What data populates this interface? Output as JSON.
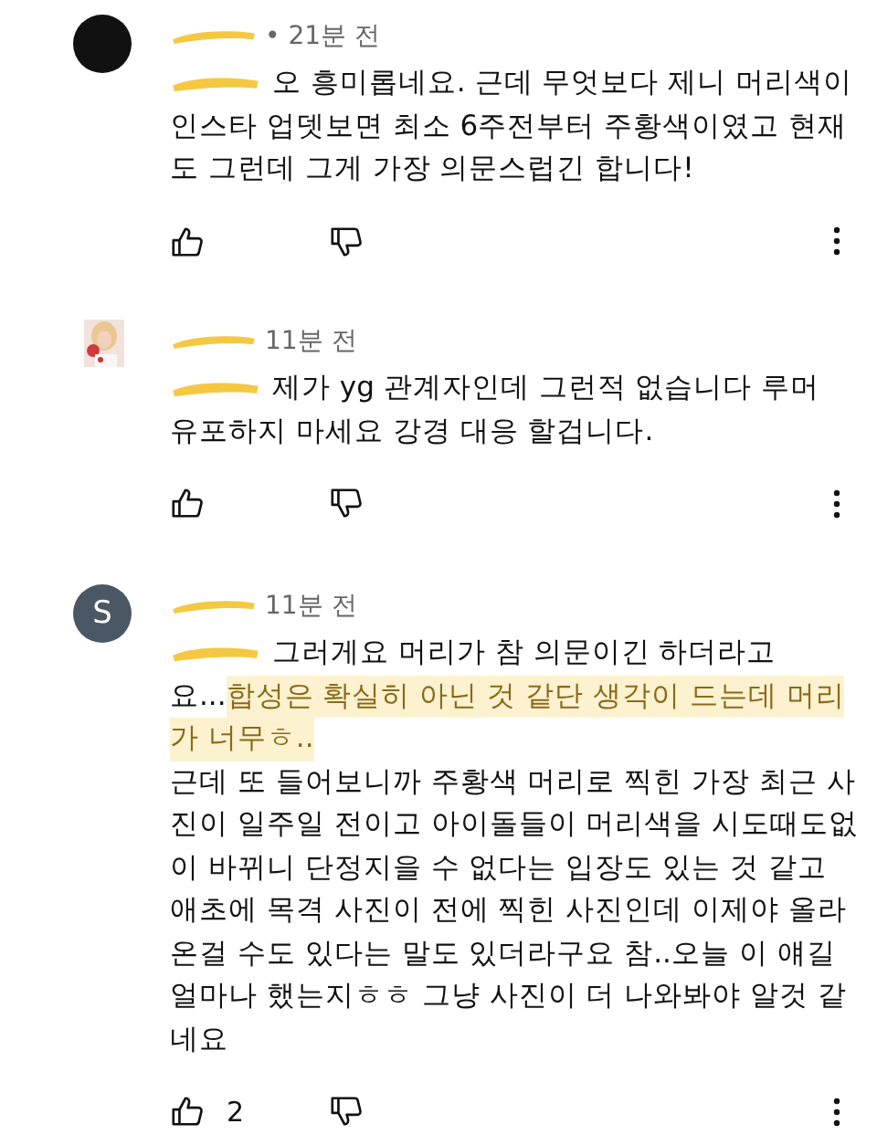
{
  "comments": [
    {
      "avatar": {
        "kind": "dark"
      },
      "author_redacted": true,
      "time": "• 21분 전",
      "mention_redacted": true,
      "lines": [
        [
          {
            "text": "오 흥미롭네요. 근데 무엇보다 제니 머리색이",
            "highlighted": false
          }
        ],
        [
          {
            "text": "인스타 업뎃보면 최소 6주전부터 주황색이였고 현재",
            "highlighted": false
          }
        ],
        [
          {
            "text": "도 그런데 그게 가장 의문스럽긴 합니다!",
            "highlighted": false
          }
        ]
      ]
    },
    {
      "avatar": {
        "kind": "picture"
      },
      "author_redacted": true,
      "time": "11분 전",
      "mention_redacted": true,
      "lines": [
        [
          {
            "text": "제가 yg 관계자인데 그런적 없습니다 루머",
            "highlighted": false
          }
        ],
        [
          {
            "text": "유포하지 마세요 강경 대응 할겁니다.",
            "highlighted": false
          }
        ]
      ]
    },
    {
      "avatar": {
        "kind": "letter",
        "letter": "S"
      },
      "author_redacted": true,
      "time": "11분 전",
      "mention_redacted": true,
      "lines": [
        [
          {
            "text": "그러게요 머리가 참 의문이긴 하더라고",
            "highlighted": false
          }
        ],
        [
          {
            "text": "요... ",
            "highlighted": false
          },
          {
            "text": "합성은 확실히 아닌 것 같단 생각이 드는데 머리",
            "highlighted": true
          }
        ],
        [
          {
            "text": "가 너무ㅎ..",
            "highlighted": true
          }
        ],
        [
          {
            "text": "근데 또 들어보니까 주황색 머리로 찍힌 가장 최근 사",
            "highlighted": false
          }
        ],
        [
          {
            "text": "진이 일주일 전이고 아이돌들이 머리색을 시도때도없",
            "highlighted": false
          }
        ],
        [
          {
            "text": "이 바뀌니 단정지을 수 없다는 입장도 있는 것 같고",
            "highlighted": false
          }
        ],
        [
          {
            "text": "애초에 목격 사진이 전에 찍힌 사진인데 이제야 올라",
            "highlighted": false
          }
        ],
        [
          {
            "text": "온걸 수도 있다는 말도 있더라구요 참..오늘 이 얘길",
            "highlighted": false
          }
        ],
        [
          {
            "text": "얼마나 했는지ㅎㅎ 그냥 사진이 더 나와봐야 알것 같",
            "highlighted": false
          }
        ],
        [
          {
            "text": "네요",
            "highlighted": false
          }
        ]
      ],
      "likes": "2"
    }
  ]
}
